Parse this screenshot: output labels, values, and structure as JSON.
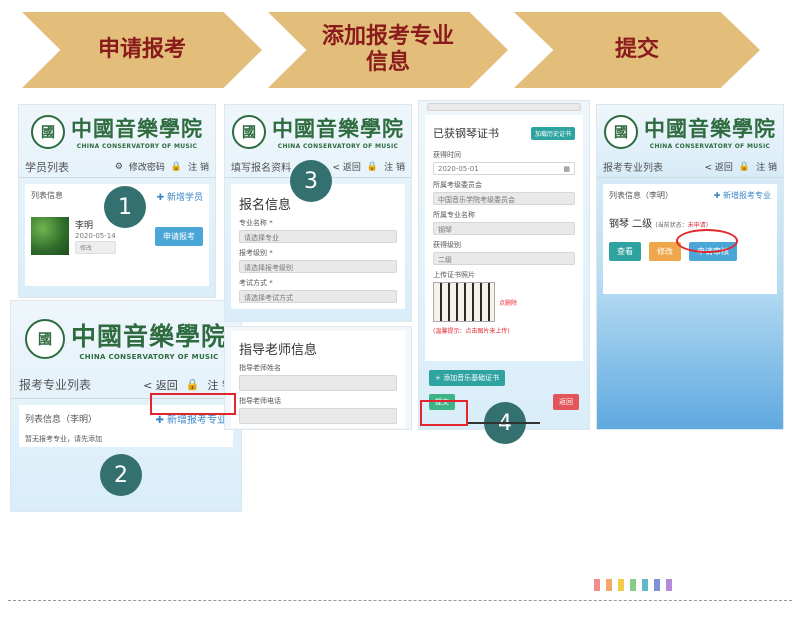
{
  "banner": {
    "step1": "申请报考",
    "step2": "添加报考专业信息",
    "step3": "提交"
  },
  "logo": {
    "emblem": "國",
    "cn": "中國音樂學院",
    "en": "CHINA CONSERVATORY OF MUSIC"
  },
  "p1": {
    "nav_title": "学员列表",
    "modify_pwd": "修改密码",
    "logout": "注 销",
    "list_info": "列表信息",
    "add_student": "✚ 新增学员",
    "student_name": "李明",
    "student_date": "2020-05-14",
    "edit": "修改",
    "apply": "申请报考"
  },
  "p2": {
    "nav_title": "报考专业列表",
    "back": "< 返回",
    "logout": "注 销",
    "list_info": "列表信息（李明）",
    "add_major": "✚ 新增报考专业",
    "empty": "暂无报考专业，请先添加"
  },
  "p3": {
    "nav_title": "填写报名资料",
    "back": "< 返回",
    "logout": "注 销",
    "section": "报名信息",
    "major_label": "专业名称 *",
    "major_ph": "请选择专业",
    "level_label": "报考级别 *",
    "level_ph": "请选择报考级别",
    "method_label": "考试方式 *",
    "method_ph": "请选择考试方式",
    "teacher_section": "指导老师信息",
    "teacher_name": "指导老师姓名",
    "teacher_phone": "指导老师电话"
  },
  "p4": {
    "cert_title": "已获钢琴证书",
    "add_history": "加载历史证书",
    "time_label": "获得时间",
    "time_value": "2020-05-01",
    "committee_label": "所属考级委员会",
    "committee_value": "中国音乐学院考级委员会",
    "major_label": "所属专业名称",
    "major_value": "钢琴",
    "level_label": "获得级别",
    "level_value": "二级",
    "upload_label": "上传证书照片",
    "delete": "点删除",
    "hint": "(温馨提示：点击图片来上传)",
    "add_cert": "+ 添加音乐基础证书",
    "submit": "提交",
    "back": "返回"
  },
  "p5": {
    "nav_title": "报考专业列表",
    "back": "< 返回",
    "logout": "注 销",
    "list_info": "列表信息（李明）",
    "add_major": "✚ 新增报考专业",
    "entry_name": "钢琴  二级",
    "status_label": "(当前状态：",
    "status_value": "未申请",
    "status_close": ")",
    "view": "查看",
    "edit": "修改",
    "submit_review": "申请审核"
  },
  "steps": {
    "n1": "1",
    "n2": "2",
    "n3": "3",
    "n4": "4"
  },
  "colors": {
    "banner": "#e3bd7a",
    "banner_text": "#8a1b1b",
    "step_circle": "#33706f",
    "highlight": "#e3262e"
  },
  "swatches": [
    "#f08c8c",
    "#f5a86a",
    "#f3cd4a",
    "#89c98a",
    "#63b8c8",
    "#7c91d6",
    "#b48bd8"
  ]
}
